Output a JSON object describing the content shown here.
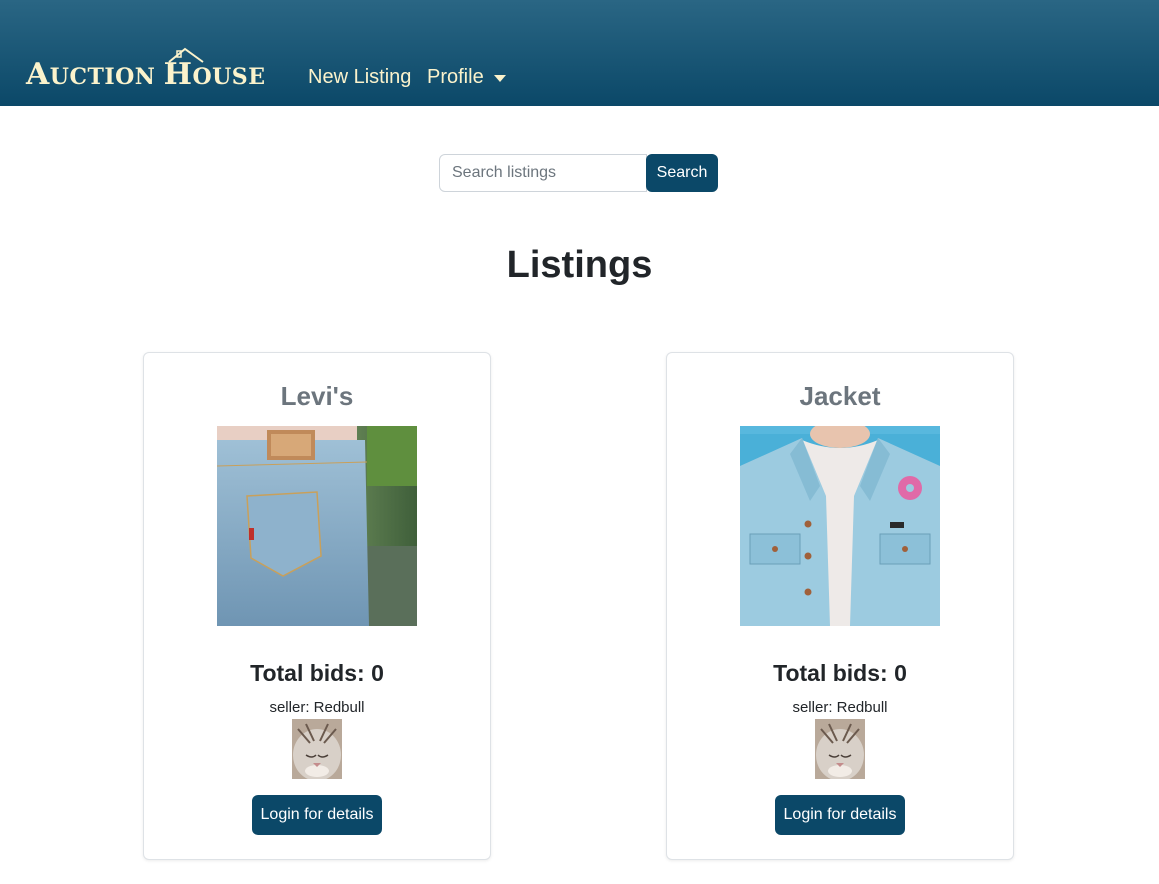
{
  "navbar": {
    "brand": {
      "cap1": "A",
      "rest1": "UCTION",
      "cap2": "H",
      "rest2": "OUSE"
    },
    "links": {
      "new_listing": "New Listing",
      "profile": "Profile"
    }
  },
  "search": {
    "placeholder": "Search listings",
    "button_label": "Search"
  },
  "page_title": "Listings",
  "listings": [
    {
      "title": "Levi's",
      "image_icon": "jeans-photo",
      "bids_text": "Total bids: 0",
      "seller_text": "seller: Redbull",
      "avatar_icon": "cat-avatar",
      "button_label": "Login for details"
    },
    {
      "title": "Jacket",
      "image_icon": "denim-jacket-photo",
      "bids_text": "Total bids: 0",
      "seller_text": "seller: Redbull",
      "avatar_icon": "cat-avatar",
      "button_label": "Login for details"
    }
  ],
  "colors": {
    "nav_top": "#2a6684",
    "nav_bottom": "#0b4868",
    "brand_text": "#fbf3cc",
    "button_bg": "#0b4868",
    "card_title": "#6c757d"
  }
}
